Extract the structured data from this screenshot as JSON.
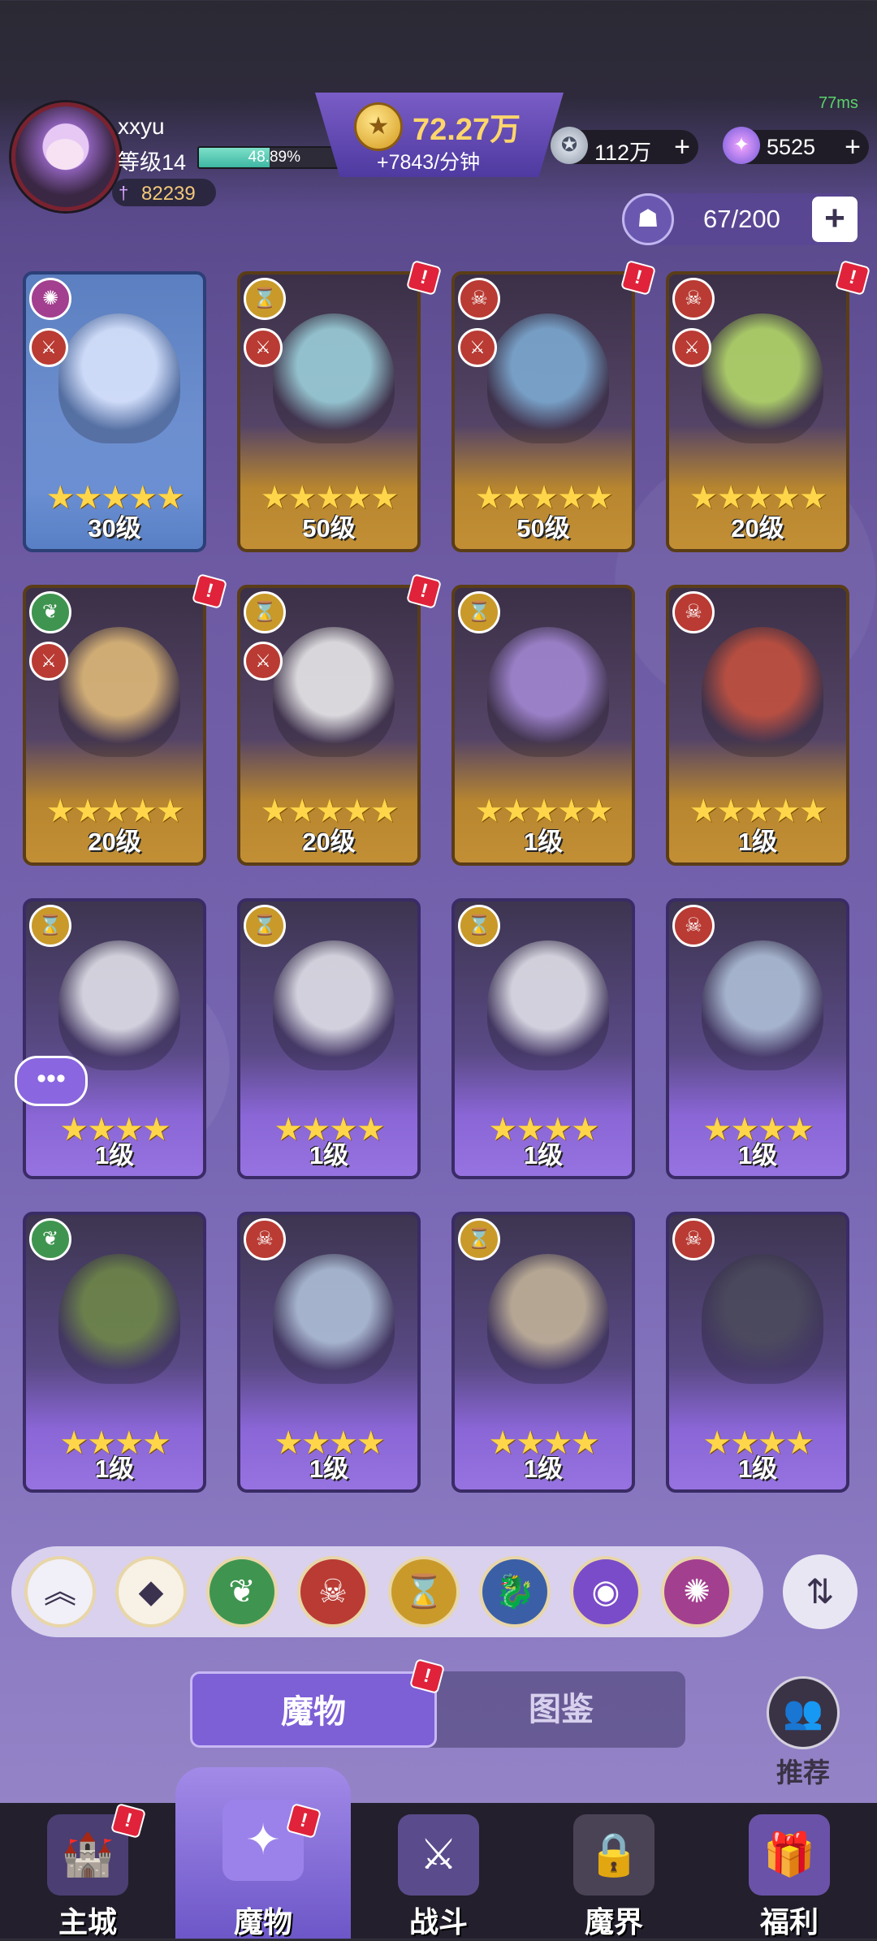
{
  "status": {
    "latency": "77ms"
  },
  "player": {
    "name": "xxyu",
    "level_label": "等级14",
    "exp_percent": "48.89%",
    "exp_fraction": 0.4889,
    "power": "82239"
  },
  "currency": {
    "gold_amount": "72.27万",
    "gold_rate": "+7843/分钟",
    "silver": "112万",
    "gems": "5525"
  },
  "monster_capacity": "67/200",
  "cards": [
    {
      "level": "30级",
      "stars": "★★★★★",
      "rarity": "blue",
      "badge": "void-badge",
      "sword": true,
      "alert": false
    },
    {
      "level": "50级",
      "stars": "★★★★★",
      "rarity": "gold",
      "badge": "hourglass-badge",
      "sword": true,
      "alert": true
    },
    {
      "level": "50级",
      "stars": "★★★★★",
      "rarity": "gold",
      "badge": "demon-badge",
      "sword": true,
      "alert": true
    },
    {
      "level": "20级",
      "stars": "★★★★★",
      "rarity": "gold",
      "badge": "demon-badge",
      "sword": true,
      "alert": true
    },
    {
      "level": "20级",
      "stars": "★★★★★",
      "rarity": "gold",
      "badge": "nature-badge",
      "sword": true,
      "alert": true
    },
    {
      "level": "20级",
      "stars": "★★★★★",
      "rarity": "gold",
      "badge": "hourglass-badge",
      "sword": true,
      "alert": true
    },
    {
      "level": "1级",
      "stars": "★★★★★",
      "rarity": "gold",
      "badge": "hourglass-badge",
      "sword": false,
      "alert": false
    },
    {
      "level": "1级",
      "stars": "★★★★★",
      "rarity": "gold",
      "badge": "demon-badge",
      "sword": false,
      "alert": false
    },
    {
      "level": "1级",
      "stars": "★★★★",
      "rarity": "purple",
      "badge": "hourglass-badge",
      "sword": false,
      "alert": false
    },
    {
      "level": "1级",
      "stars": "★★★★",
      "rarity": "purple",
      "badge": "hourglass-badge",
      "sword": false,
      "alert": false
    },
    {
      "level": "1级",
      "stars": "★★★★",
      "rarity": "purple",
      "badge": "hourglass-badge",
      "sword": false,
      "alert": false
    },
    {
      "level": "1级",
      "stars": "★★★★",
      "rarity": "purple",
      "badge": "demon-badge",
      "sword": false,
      "alert": false
    },
    {
      "level": "1级",
      "stars": "★★★★",
      "rarity": "purple",
      "badge": "nature-badge",
      "sword": false,
      "alert": false
    },
    {
      "level": "1级",
      "stars": "★★★★",
      "rarity": "purple",
      "badge": "demon-badge",
      "sword": false,
      "alert": false
    },
    {
      "level": "1级",
      "stars": "★★★★",
      "rarity": "purple",
      "badge": "hourglass-badge",
      "sword": false,
      "alert": false
    },
    {
      "level": "1级",
      "stars": "★★★★",
      "rarity": "purple",
      "badge": "demon-badge",
      "sword": false,
      "alert": false
    }
  ],
  "filters": [
    {
      "name": "collapse-filter",
      "icon": "︽",
      "bg": "#f1eff7",
      "color": "#3b3250"
    },
    {
      "name": "all-filter",
      "icon": "◆",
      "bg": "#f7f1e6",
      "color": "#3b3250"
    },
    {
      "name": "nature-filter",
      "icon": "❦",
      "bg": "#3f9550",
      "color": "#ffffff"
    },
    {
      "name": "demon-filter",
      "icon": "☠",
      "bg": "#b93b33",
      "color": "#ffffff"
    },
    {
      "name": "hourglass-filter",
      "icon": "⌛",
      "bg": "#c99a2a",
      "color": "#ffffff"
    },
    {
      "name": "dragon-filter",
      "icon": "🐉",
      "bg": "#3b5fa6",
      "color": "#ffffff"
    },
    {
      "name": "eye-filter",
      "icon": "◉",
      "bg": "#7a4cc9",
      "color": "#ffffff"
    },
    {
      "name": "void-filter",
      "icon": "✺",
      "bg": "#a33f8f",
      "color": "#ffffff"
    }
  ],
  "tabs": {
    "monsters": "魔物",
    "codex": "图鉴"
  },
  "recommend_label": "推荐",
  "nav": {
    "city": "主城",
    "monsters": "魔物",
    "battle": "战斗",
    "realm": "魔界",
    "welfare": "福利"
  }
}
